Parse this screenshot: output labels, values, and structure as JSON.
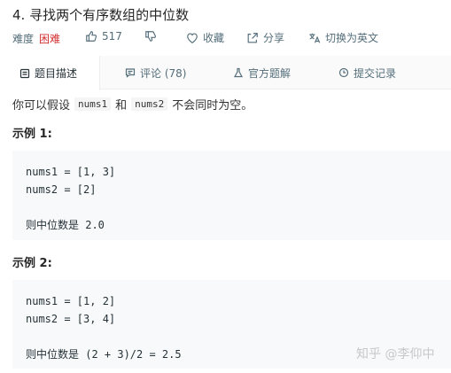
{
  "problem": {
    "title": "4. 寻找两个有序数组的中位数",
    "difficulty_label": "难度",
    "difficulty_value": "困难",
    "likes": "517",
    "collect_label": "收藏",
    "share_label": "分享",
    "switch_lang_label": "切换为英文"
  },
  "tabs": [
    {
      "label": "题目描述",
      "icon": "document-icon",
      "active": true
    },
    {
      "label": "评论 (78)",
      "icon": "comment-icon",
      "active": false
    },
    {
      "label": "官方题解",
      "icon": "flask-icon",
      "active": false
    },
    {
      "label": "提交记录",
      "icon": "clock-icon",
      "active": false
    }
  ],
  "description": {
    "prefix": "你可以假设",
    "code1": "nums1",
    "mid": "和",
    "code2": "nums2",
    "suffix": "不会同时为空。"
  },
  "examples": [
    {
      "title": "示例 1:",
      "line1": "nums1 = [1, 3]",
      "line2": "nums2 = [2]",
      "result": "则中位数是 2.0"
    },
    {
      "title": "示例 2:",
      "line1": "nums1 = [1, 2]",
      "line2": "nums2 = [3, 4]",
      "result": "则中位数是 (2 + 3)/2 = 2.5"
    }
  ],
  "watermark": "知乎 @李仰中",
  "colors": {
    "difficulty_hard": "#d32f2f",
    "meta_text": "#546e7a",
    "code_bg": "#f7f9fa"
  }
}
